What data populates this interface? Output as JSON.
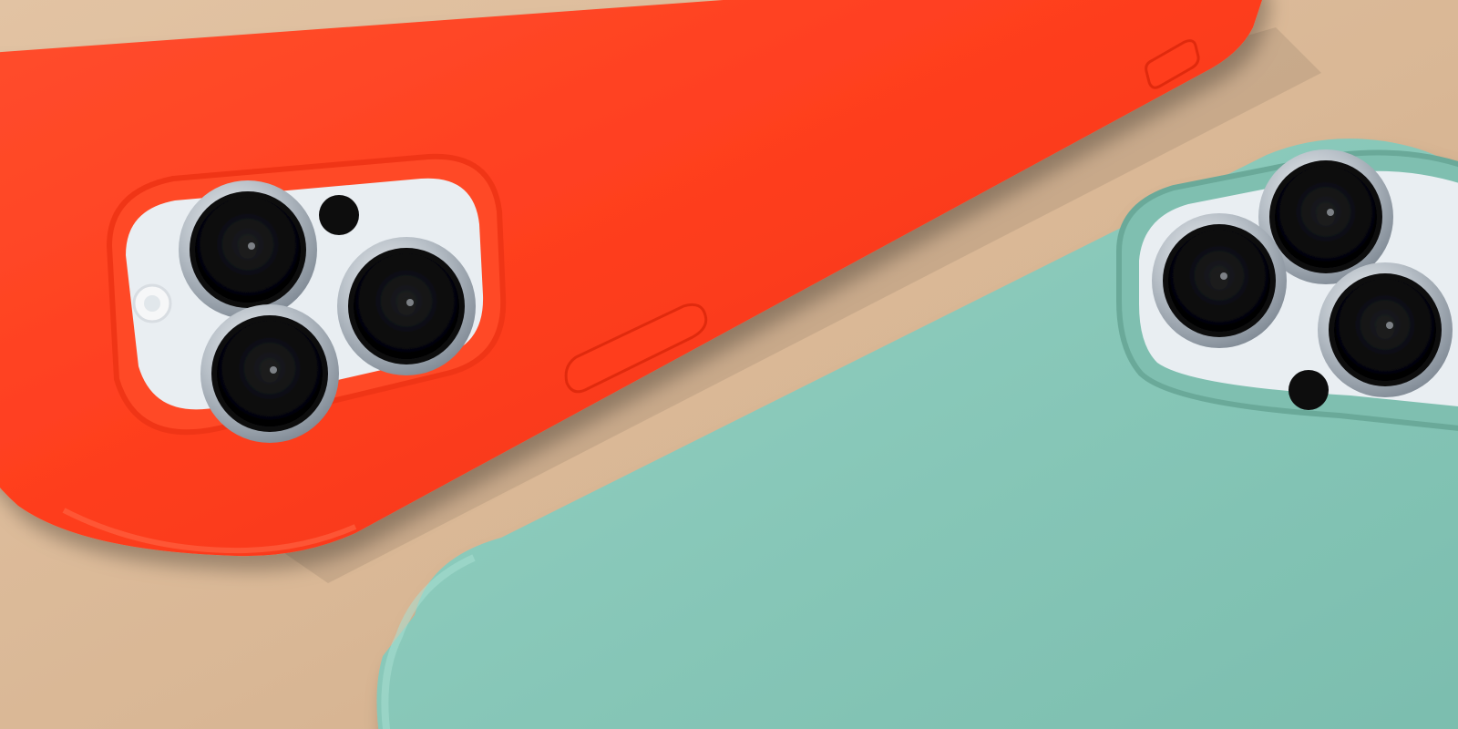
{
  "image": {
    "kind": "photo",
    "subjects": [
      "orange-phone-case",
      "green-phone-case"
    ]
  },
  "colors": {
    "background": "#d9b795",
    "background_shade": "#c9a683",
    "orange_case": "#ff3f1f",
    "orange_case_dark": "#e62d14",
    "orange_case_light": "#ff5a36",
    "green_case": "#86c6b7",
    "green_case_dark": "#6fb3a3",
    "green_case_light": "#9bd5c7",
    "camera_plate": "#e9eef2",
    "lens_ring": "#b9c0c6",
    "lens_glass": "#0b0b0d"
  },
  "icons": {
    "orange_lenses": [
      "lens-icon",
      "lens-icon",
      "lens-icon"
    ],
    "green_lenses": [
      "lens-icon",
      "lens-icon",
      "lens-icon"
    ]
  }
}
